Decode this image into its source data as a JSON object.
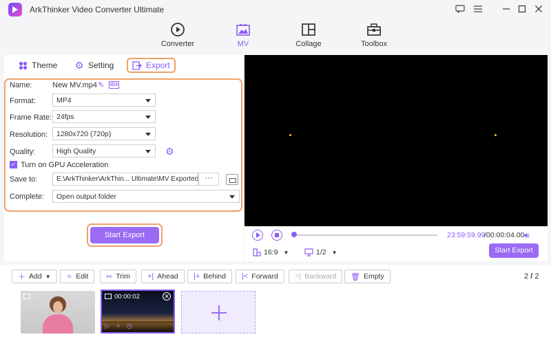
{
  "app": {
    "title": "ArkThinker Video Converter Ultimate",
    "accent_color": "#8a5cf6",
    "highlight_color": "#f0a06a"
  },
  "window_controls": [
    "chat-icon",
    "menu-icon",
    "minimize-icon",
    "maximize-icon",
    "close-icon"
  ],
  "nav": {
    "items": [
      {
        "label": "Converter",
        "icon": "converter-icon",
        "active": false
      },
      {
        "label": "MV",
        "icon": "mv-icon",
        "active": true
      },
      {
        "label": "Collage",
        "icon": "collage-icon",
        "active": false
      },
      {
        "label": "Toolbox",
        "icon": "toolbox-icon",
        "active": false
      }
    ]
  },
  "tabs": {
    "theme": "Theme",
    "setting": "Setting",
    "export": "Export"
  },
  "export_form": {
    "name_label": "Name:",
    "name_value": "New MV.mp4",
    "format_label": "Format:",
    "format_value": "MP4",
    "framerate_label": "Frame Rate:",
    "framerate_value": "24fps",
    "resolution_label": "Resolution:",
    "resolution_value": "1280x720 (720p)",
    "quality_label": "Quality:",
    "quality_value": "High Quality",
    "gpu_label": "Turn on GPU Acceleration",
    "gpu_checked": true,
    "saveto_label": "Save to:",
    "saveto_value": "E:\\ArkThinker\\ArkThin... Ultimate\\MV Exported",
    "saveto_browse": "···",
    "complete_label": "Complete:",
    "complete_value": "Open output folder",
    "start_export": "Start Export"
  },
  "player": {
    "current_time": "23:59:59.99",
    "total_time": "/00:00:04.00",
    "aspect_ratio": "16:9",
    "page": "1/2",
    "start_export": "Start Export"
  },
  "toolbar": {
    "add": "Add",
    "edit": "Edit",
    "trim": "Trim",
    "ahead": "Ahead",
    "behind": "Behind",
    "forward": "Forward",
    "backward": "Backward",
    "empty": "Empty",
    "pager_current": "2",
    "pager_total": "2"
  },
  "clips": {
    "clip2_duration": "00:00:02"
  }
}
